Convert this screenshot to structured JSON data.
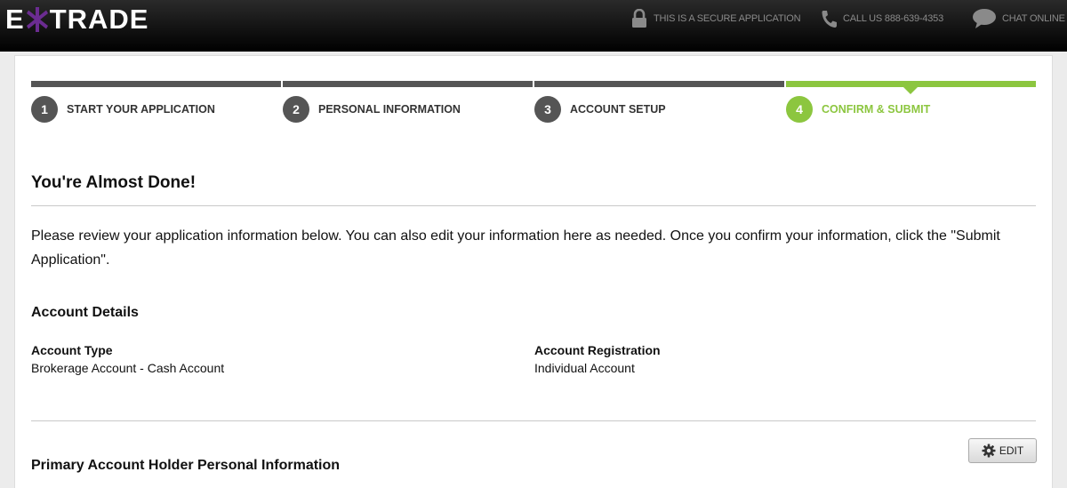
{
  "header": {
    "logo_left": "E",
    "logo_right": "TRADE",
    "secure_text": "THIS IS A SECURE APPLICATION",
    "call_text": "CALL US 888-639-4353",
    "chat_text": "CHAT ONLINE",
    "icons": [
      "lock-icon",
      "phone-icon",
      "chat-bubble-icon"
    ]
  },
  "steps": [
    {
      "number": "1",
      "label": "START YOUR APPLICATION",
      "active": false
    },
    {
      "number": "2",
      "label": "PERSONAL INFORMATION",
      "active": false
    },
    {
      "number": "3",
      "label": "ACCOUNT SETUP",
      "active": false
    },
    {
      "number": "4",
      "label": "CONFIRM & SUBMIT",
      "active": true
    }
  ],
  "page": {
    "title": "You're Almost Done!",
    "intro": "Please review your application information below. You can also edit your information here as needed. Once you confirm your information, click the \"Submit Application\"."
  },
  "account_details": {
    "heading": "Account Details",
    "type_label": "Account Type",
    "type_value": "Brokerage Account - Cash Account",
    "registration_label": "Account Registration",
    "registration_value": "Individual Account"
  },
  "primary_holder": {
    "heading": "Primary Account Holder Personal Information",
    "edit_label": "EDIT"
  },
  "colors": {
    "accent": "#8cc63f",
    "step_inactive": "#555555",
    "logo_star": "#6b2c91"
  }
}
